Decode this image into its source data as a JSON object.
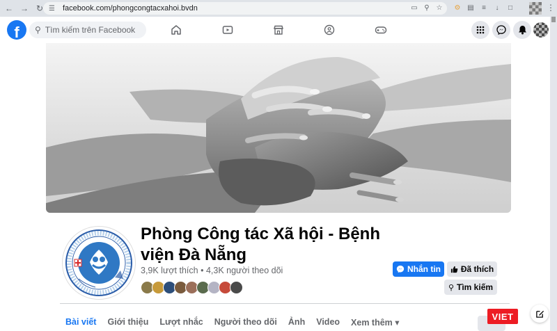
{
  "browser": {
    "url": "facebook.com/phongcongtacxahoi.bvdn"
  },
  "fb_header": {
    "search_placeholder": "Tìm kiếm trên Facebook",
    "nav_items": [
      "home-icon",
      "video-icon",
      "marketplace-icon",
      "groups-icon",
      "gaming-icon"
    ],
    "brand_color": "#1877f2"
  },
  "page": {
    "title": "Phòng Công tác Xã hội - Bệnh viện Đà Nẵng",
    "likes": "3,9K lượt thích",
    "separator": "•",
    "followers": "4,3K người theo dõi"
  },
  "actions": {
    "message": "Nhắn tin",
    "liked": "Đã thích",
    "search": "Tìm kiếm",
    "more": "..."
  },
  "tabs": [
    {
      "label": "Bài viết",
      "active": true
    },
    {
      "label": "Giới thiệu",
      "active": false
    },
    {
      "label": "Lượt nhắc",
      "active": false
    },
    {
      "label": "Người theo dõi",
      "active": false
    },
    {
      "label": "Ảnh",
      "active": false
    },
    {
      "label": "Video",
      "active": false
    },
    {
      "label": "Xem thêm ▾",
      "active": false
    }
  ],
  "watermark": "VIET"
}
